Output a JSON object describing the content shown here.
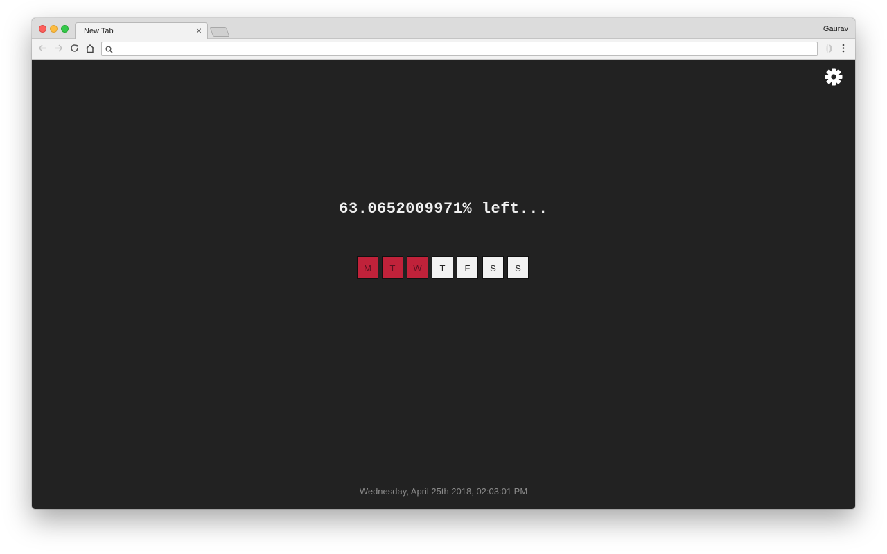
{
  "browser": {
    "tab_title": "New Tab",
    "tab_close_icon": "close-icon",
    "profile_name": "Gaurav",
    "address_value": "",
    "controls": [
      "back-arrow-icon",
      "forward-arrow-icon",
      "reload-icon",
      "home-icon"
    ],
    "colors": {
      "close": "#fc605c",
      "minimize": "#fdbc40",
      "maximize": "#34c84a"
    }
  },
  "page": {
    "settings_icon": "gear-icon",
    "progress_text": "63.0652009971% left...",
    "progress_percent_left": 63.0652009971,
    "days": [
      {
        "label": "M",
        "done": true
      },
      {
        "label": "T",
        "done": true
      },
      {
        "label": "W",
        "done": true
      },
      {
        "label": "T",
        "done": false
      },
      {
        "label": "F",
        "done": false
      },
      {
        "label": "S",
        "done": false
      },
      {
        "label": "S",
        "done": false
      }
    ],
    "datetime": "Wednesday, April 25th 2018, 02:03:01 PM",
    "colors": {
      "background": "#222222",
      "day_done": "#c0223a",
      "day_todo": "#f2f2f2",
      "text": "#f0f0f0",
      "footer_text": "#8a8a8a"
    }
  }
}
